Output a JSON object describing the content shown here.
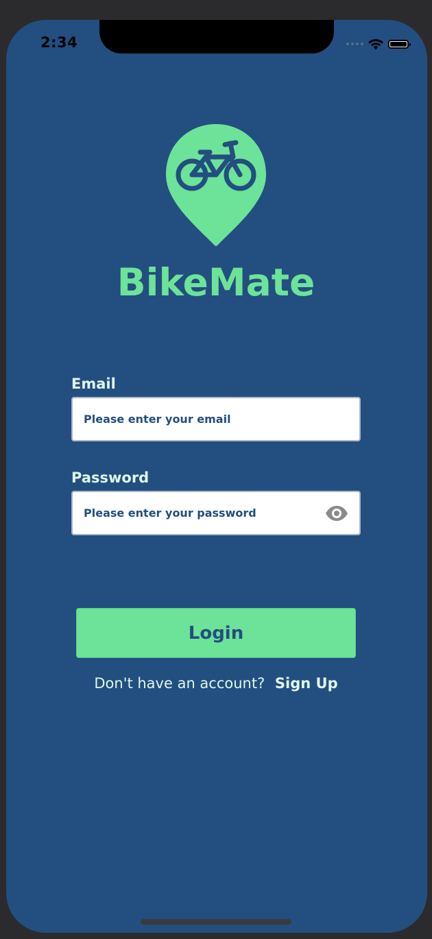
{
  "status_bar": {
    "time": "2:34"
  },
  "app": {
    "name": "BikeMate",
    "logo_icon": "bike-location-pin-icon"
  },
  "form": {
    "email": {
      "label": "Email",
      "placeholder": "Please enter your email",
      "value": ""
    },
    "password": {
      "label": "Password",
      "placeholder": "Please enter your password",
      "value": "",
      "toggle_icon": "eye-icon"
    },
    "login_label": "Login",
    "signup_prompt": "Don't have an account?",
    "signup_label": "Sign Up"
  },
  "colors": {
    "background": "#234e80",
    "accent": "#6ce398",
    "text_light": "#dff7ec"
  }
}
